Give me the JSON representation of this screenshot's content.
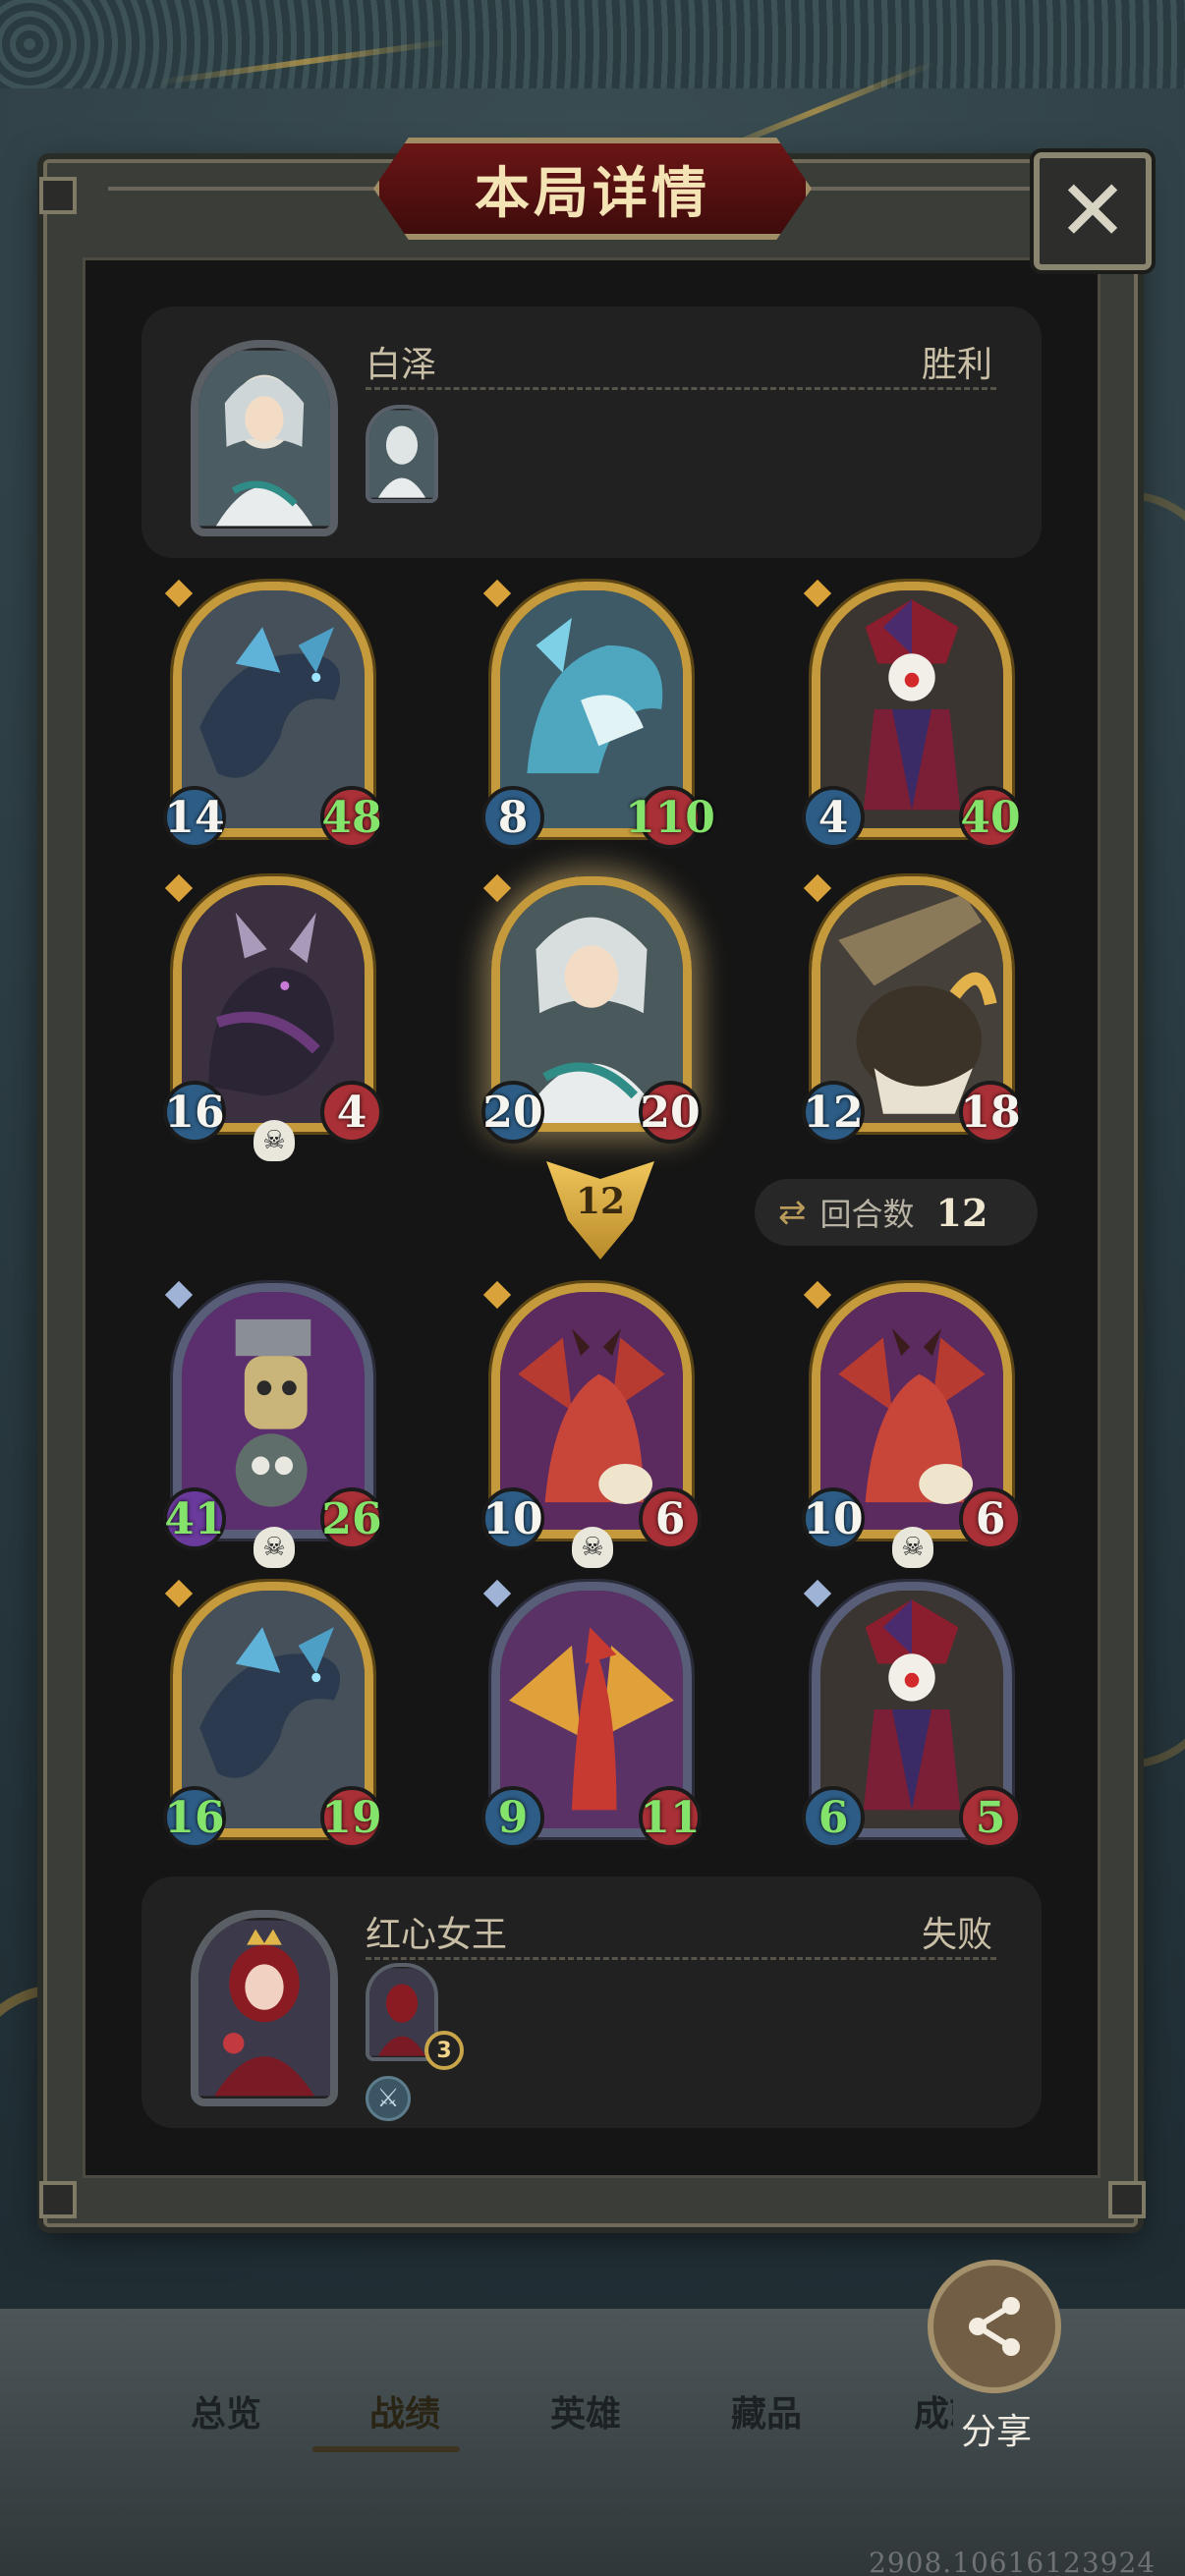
{
  "title": "本局详情",
  "close_label": "✕",
  "player1": {
    "name": "白泽",
    "result": "胜利",
    "portrait_icon": "hero-baize-portrait"
  },
  "player2": {
    "name": "红心女王",
    "result": "失败",
    "portrait_icon": "hero-red-queen-portrait",
    "card_count": "3"
  },
  "board_top": [
    {
      "name": "dark-dragon",
      "atk": "14",
      "hp": "48",
      "hp_color": "green",
      "frame": "gold",
      "dead": false
    },
    {
      "name": "ice-dragon",
      "atk": "8",
      "hp": "110",
      "hp_color": "green",
      "frame": "gold",
      "dead": false
    },
    {
      "name": "clown-jester",
      "atk": "4",
      "hp": "40",
      "hp_color": "green",
      "frame": "gold",
      "dead": false
    },
    {
      "name": "shadow-dragon",
      "atk": "16",
      "hp": "4",
      "hp_color": "white",
      "frame": "gold",
      "dead": true
    },
    {
      "name": "baize-hero",
      "atk": "20",
      "hp": "20",
      "hp_color": "white",
      "frame": "gold",
      "dead": false,
      "highlight": true
    },
    {
      "name": "boar-beast",
      "atk": "12",
      "hp": "18",
      "hp_color": "white",
      "frame": "gold",
      "dead": false
    }
  ],
  "damage_arrow": "12",
  "rounds": {
    "label": "回合数",
    "value": "12"
  },
  "board_bottom": [
    {
      "name": "robot-golem",
      "atk": "41",
      "hp": "26",
      "atk_color": "green",
      "hp_color": "green",
      "frame": "purple",
      "dead": true
    },
    {
      "name": "red-dragon",
      "atk": "10",
      "hp": "6",
      "frame": "gold",
      "dead": true
    },
    {
      "name": "red-dragon",
      "atk": "10",
      "hp": "6",
      "frame": "gold",
      "dead": true
    },
    {
      "name": "dark-dragon",
      "atk": "16",
      "hp": "19",
      "atk_color": "green",
      "hp_color": "green",
      "frame": "gold",
      "dead": false
    },
    {
      "name": "fire-dragon",
      "atk": "9",
      "hp": "11",
      "atk_color": "green",
      "hp_color": "green",
      "frame": "purple",
      "dead": false
    },
    {
      "name": "clown-jester",
      "atk": "6",
      "hp": "5",
      "atk_color": "green",
      "hp_color": "green",
      "frame": "purple",
      "dead": false
    }
  ],
  "nav": {
    "items": [
      "总览",
      "战绩",
      "英雄",
      "藏品",
      "成就"
    ],
    "active": "战绩"
  },
  "share_label": "分享",
  "footer_id": "2908.10616123924",
  "colors": {
    "gold_frame": "#c49a3c",
    "purple_frame": "#585e78",
    "hp_red": "#a83036",
    "atk_blue": "#2d5d86",
    "stat_green": "#84e36a"
  }
}
